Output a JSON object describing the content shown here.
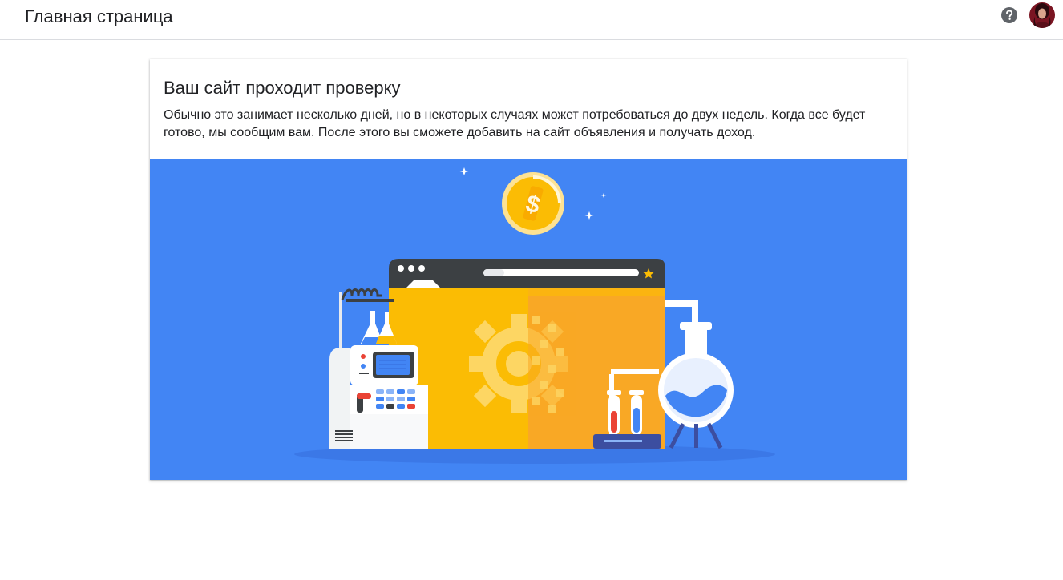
{
  "header": {
    "title": "Главная страница",
    "help_icon": "help-circle-icon",
    "avatar_icon": "user-avatar"
  },
  "card": {
    "title": "Ваш сайт проходит проверку",
    "body": "Обычно это занимает несколько дней, но в некоторых случаях может потребоваться до двух недель. Когда все будет готово, мы сообщим вам. После этого вы сможете добавить на сайт объявления и получать доход."
  },
  "colors": {
    "illustration_bg": "#4285f4",
    "accent_yellow": "#fbbc04",
    "accent_orange": "#f29900",
    "dark_gray": "#3c4043",
    "red": "#ea4335"
  }
}
